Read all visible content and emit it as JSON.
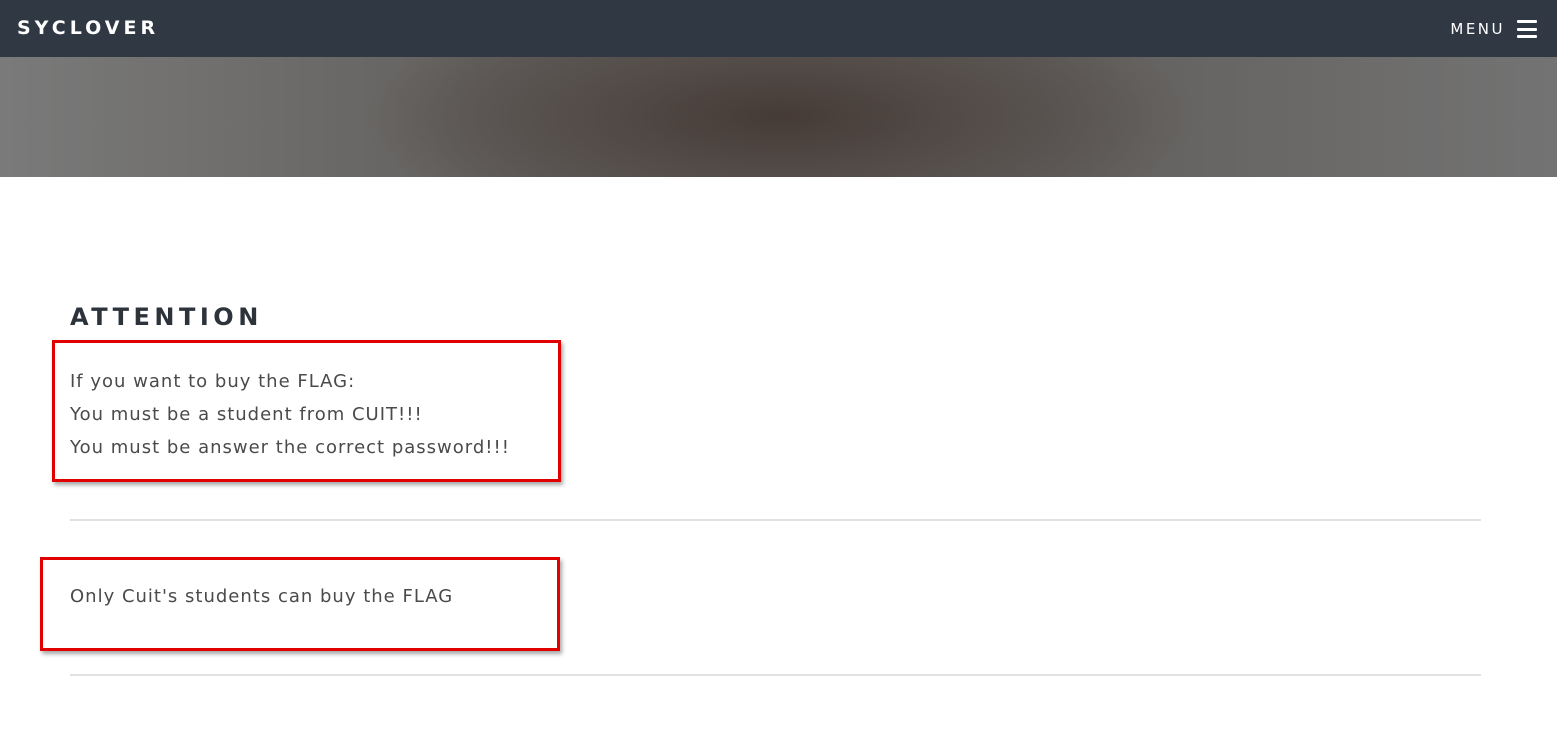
{
  "navbar": {
    "brand": "SYCLOVER",
    "menu_label": "MENU"
  },
  "main": {
    "heading": "ATTENTION",
    "notice_lines": [
      "If you want to buy the FLAG:",
      "You must be a student from CUIT!!!",
      "You must be answer the correct password!!!"
    ],
    "message": "Only Cuit's students can buy the FLAG"
  },
  "colors": {
    "navbar_bg": "#2f3843",
    "highlight": "#e00000",
    "heading": "#2d333b",
    "body_text": "#4a4a4a",
    "divider": "#e1e1e1"
  },
  "icons": {
    "menu": "hamburger-icon"
  }
}
